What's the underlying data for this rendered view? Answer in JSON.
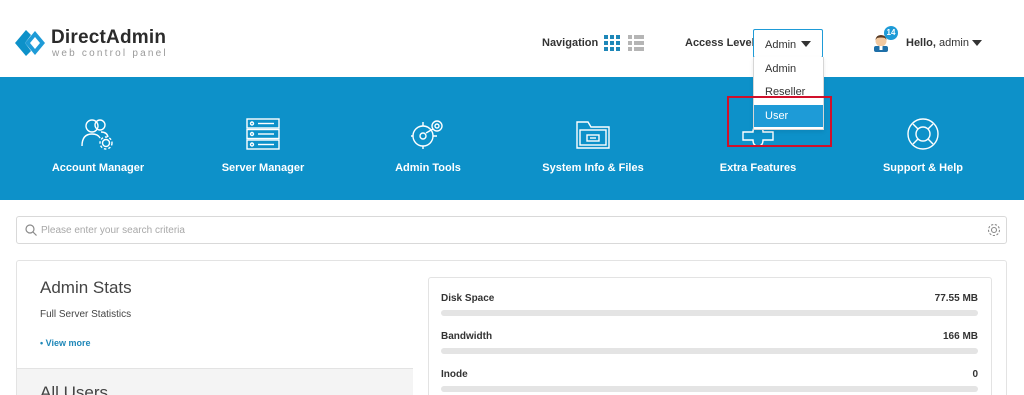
{
  "header": {
    "brand": "DirectAdmin",
    "tagline": "web control panel",
    "navigation_label": "Navigation",
    "access_level_label": "Access Level",
    "access_level_value": "Admin",
    "access_level_options": [
      "Admin",
      "Reseller",
      "User"
    ],
    "notification_count": "14",
    "hello_prefix": "Hello,",
    "hello_user": "admin"
  },
  "menu": [
    {
      "label": "Account Manager",
      "icon": "users-gear-icon"
    },
    {
      "label": "Server Manager",
      "icon": "server-rack-icon"
    },
    {
      "label": "Admin Tools",
      "icon": "admin-tools-icon"
    },
    {
      "label": "System Info & Files",
      "icon": "folder-icon"
    },
    {
      "label": "Extra Features",
      "icon": "puzzle-icon"
    },
    {
      "label": "Support & Help",
      "icon": "lifebuoy-icon"
    }
  ],
  "search": {
    "placeholder": "Please enter your search criteria"
  },
  "stats": {
    "title": "Admin Stats",
    "subtitle": "Full Server Statistics",
    "view_more": "• View more",
    "users_title": "All Users",
    "metrics": [
      {
        "name": "Disk Space",
        "value": "77.55 MB",
        "fill_percent": 0
      },
      {
        "name": "Bandwidth",
        "value": "166 MB",
        "fill_percent": 0
      },
      {
        "name": "Inode",
        "value": "0",
        "fill_percent": 0
      }
    ]
  },
  "colors": {
    "brand_blue": "#0d91c9",
    "accent_blue": "#1e9bd7",
    "highlight_red": "#d0102a"
  }
}
